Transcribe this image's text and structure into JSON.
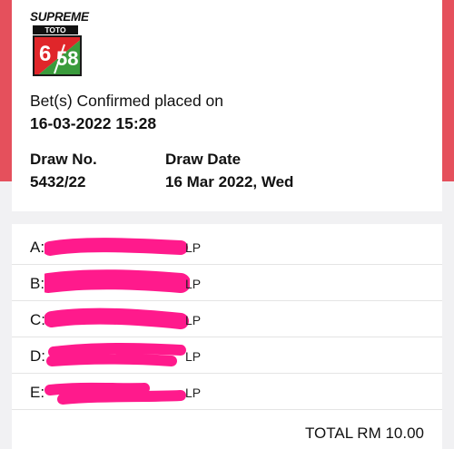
{
  "logo": {
    "brand": "SUPREME",
    "sub": "TOTO",
    "game_left": "6",
    "game_right": "58",
    "colors": {
      "green": "#3a9b3c",
      "red": "#e0262a"
    }
  },
  "confirmation": {
    "message": "Bet(s) Confirmed placed on",
    "datetime": "16-03-2022 15:28"
  },
  "draw": {
    "number_label": "Draw No.",
    "number": "5432/22",
    "date_label": "Draw Date",
    "date": "16 Mar 2022, Wed"
  },
  "bets": [
    {
      "letter": "A:",
      "suffix": "LP"
    },
    {
      "letter": "B:",
      "suffix": "LP"
    },
    {
      "letter": "C:",
      "suffix": "LP"
    },
    {
      "letter": "D:",
      "suffix": "LP"
    },
    {
      "letter": "E:",
      "suffix": "LP"
    }
  ],
  "total": "TOTAL RM 10.00",
  "colors": {
    "accent": "#e5505c",
    "redaction": "#ff1a8c"
  }
}
